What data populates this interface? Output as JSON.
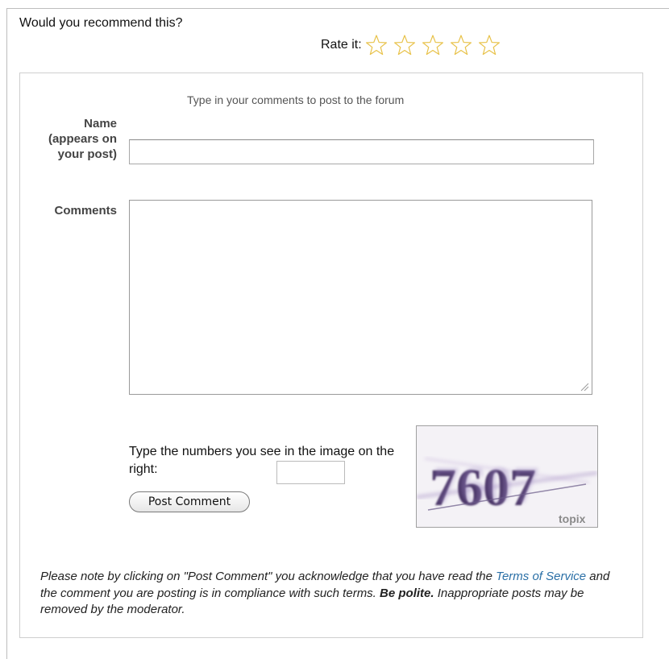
{
  "recommend": {
    "question": "Would you recommend this?",
    "rate_label": "Rate it:",
    "star_count": 5,
    "rating": 0,
    "star_color": "#e8c24a"
  },
  "form": {
    "intro": "Type in your comments to post to the forum",
    "name_label": "Name (appears on your post)",
    "name_value": "",
    "comments_label": "Comments",
    "comments_value": "",
    "captcha_prompt": "Type the numbers you see in the image on the right:",
    "captcha_value": "",
    "post_button": "Post Comment",
    "captcha_image": {
      "digits": "7607",
      "brand": "topix"
    }
  },
  "note": {
    "part1": "Please note by clicking on \"Post Comment\" you acknowledge that you have read the ",
    "tos_link": "Terms of Service",
    "part2": " and the comment you are posting is in compliance with such terms. ",
    "polite": "Be polite.",
    "part3": " Inappropriate posts may be removed by the moderator.",
    "link_color": "#2a6fa6"
  }
}
